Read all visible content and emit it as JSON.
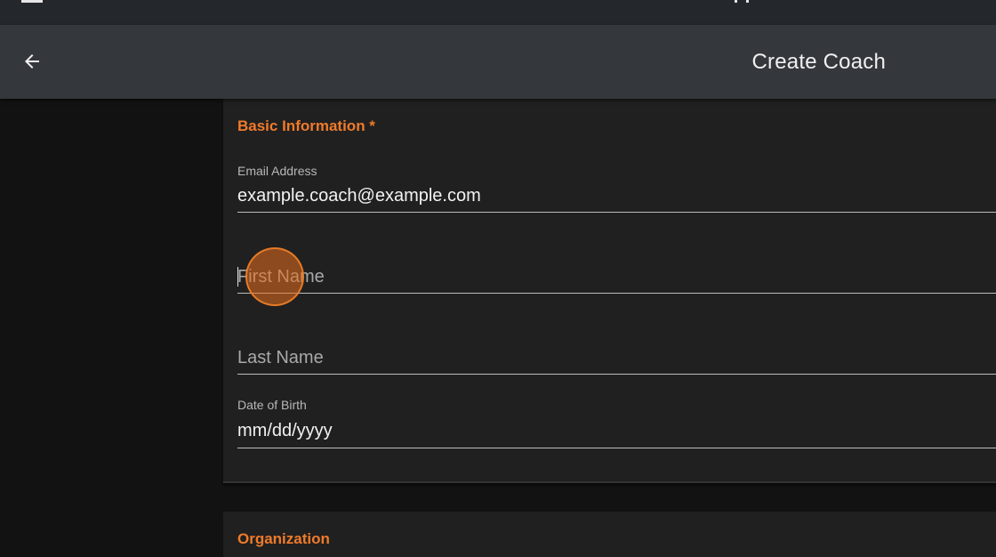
{
  "status_bar": {
    "menu_icon": "hamburger-icon",
    "tray_icon": "status-icon"
  },
  "app_bar": {
    "back_icon": "arrow-left-icon",
    "title": "Create Coach"
  },
  "basic_information": {
    "section_title": "Basic Information *",
    "email": {
      "label": "Email Address",
      "value": "example.coach@example.com"
    },
    "first_name": {
      "placeholder": "First Name"
    },
    "last_name": {
      "placeholder": "Last Name"
    },
    "date_of_birth": {
      "label": "Date of Birth",
      "value": "mm/dd/yyyy"
    }
  },
  "organization": {
    "section_title": "Organization"
  },
  "colors": {
    "accent": "#f07a2a",
    "app_bar": "#34373b",
    "card": "#202020",
    "background": "#121212"
  }
}
